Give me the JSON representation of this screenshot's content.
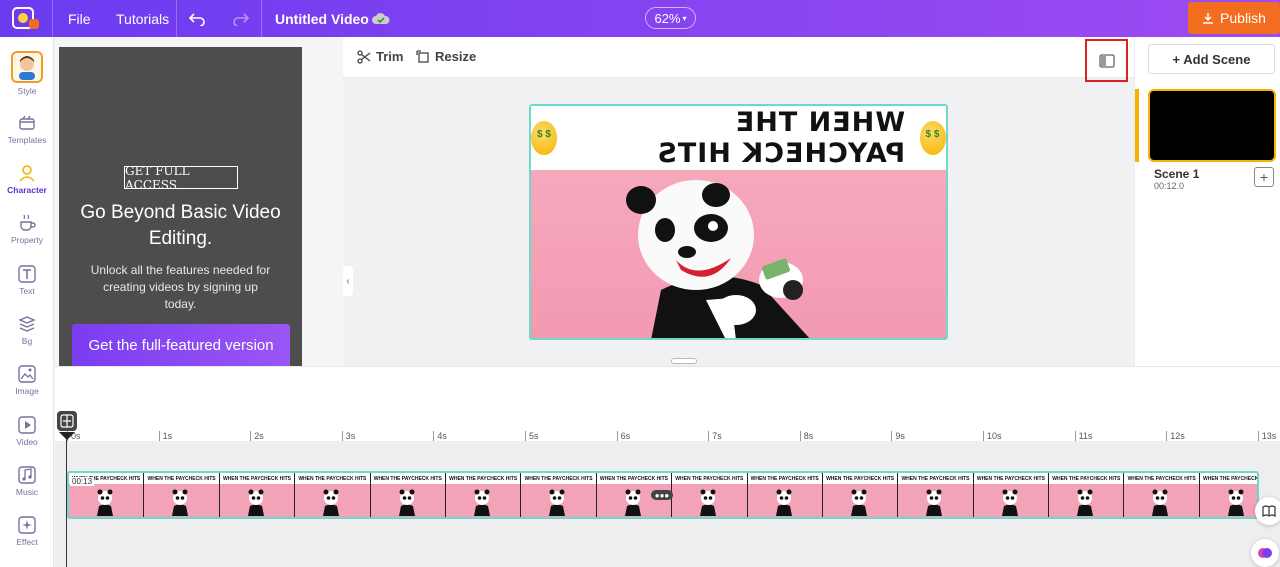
{
  "topbar": {
    "file_label": "File",
    "tutorials_label": "Tutorials",
    "project_title": "Untitled Video",
    "zoom_value": "62%",
    "publish_label": "Publish",
    "accent_color": "#f26d1f"
  },
  "sidebar": {
    "items": [
      {
        "label": "Style",
        "icon": "avatar-icon"
      },
      {
        "label": "Templates",
        "icon": "templates-icon"
      },
      {
        "label": "Character",
        "icon": "character-icon"
      },
      {
        "label": "Property",
        "icon": "property-icon"
      },
      {
        "label": "Text",
        "icon": "text-icon"
      },
      {
        "label": "Bg",
        "icon": "layers-icon"
      },
      {
        "label": "Image",
        "icon": "image-icon"
      },
      {
        "label": "Video",
        "icon": "video-icon"
      },
      {
        "label": "Music",
        "icon": "music-icon"
      },
      {
        "label": "Effect",
        "icon": "effect-icon"
      }
    ]
  },
  "promo": {
    "badge": "GET FULL ACCESS",
    "headline": "Go Beyond Basic Video Editing.",
    "subtext": "Unlock all the features needed for creating videos by signing up today.",
    "cta_label": "Get the full-featured version"
  },
  "canvas_toolbar": {
    "trim_label": "Trim",
    "resize_label": "Resize"
  },
  "video": {
    "banner_text": "WHEN THE PAYCHECK HITS"
  },
  "scenes": {
    "add_label": "+ Add Scene",
    "items": [
      {
        "name": "Scene 1",
        "duration": "00:12.0"
      }
    ]
  },
  "timeline": {
    "ticks": [
      "0s",
      "1s",
      "2s",
      "3s",
      "4s",
      "5s",
      "6s",
      "7s",
      "8s",
      "9s",
      "10s",
      "11s",
      "12s",
      "13s"
    ],
    "clip_time": "00:13",
    "frame_caption": "WHEN THE PAYCHECK HITS"
  }
}
